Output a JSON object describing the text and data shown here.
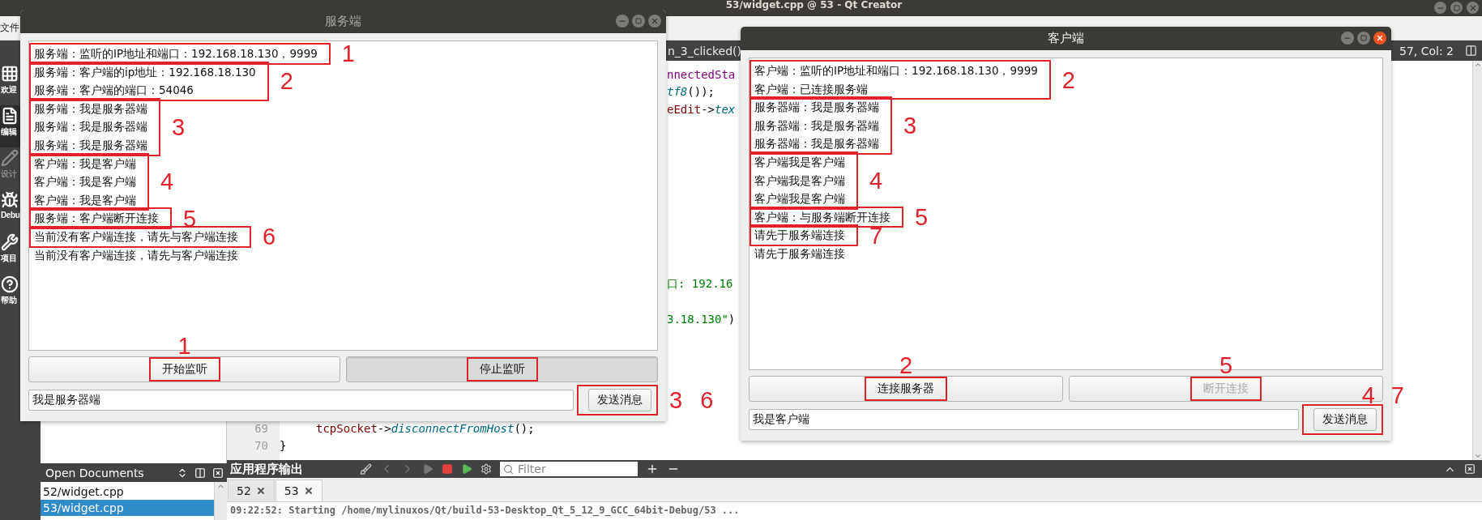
{
  "ide": {
    "title": "53/widget.cpp @ 53 - Qt Creator",
    "menu": [
      "文件"
    ],
    "modes": [
      {
        "label": "欢迎",
        "selected": false,
        "disabled": false
      },
      {
        "label": "编辑",
        "selected": true,
        "disabled": false
      },
      {
        "label": "设计",
        "selected": false,
        "disabled": true
      },
      {
        "label": "Debu",
        "selected": false,
        "disabled": false
      },
      {
        "label": "项目",
        "selected": false,
        "disabled": false
      },
      {
        "label": "帮助",
        "selected": false,
        "disabled": false
      }
    ],
    "open_documents": {
      "title": "Open Documents",
      "items": [
        {
          "name": "52/widget.cpp",
          "selected": false
        },
        {
          "name": "53/widget.cpp",
          "selected": true
        }
      ]
    },
    "editor": {
      "tab": "n_3_clicked()",
      "position": "57, Col: 2",
      "fragments": [
        {
          "tokens": [
            {
              "text": "nnectedSta",
              "kind": "member"
            }
          ]
        },
        {
          "tokens": [
            {
              "text": "tf8",
              "kind": "method"
            },
            {
              "text": "());",
              "kind": "plain"
            }
          ]
        },
        {
          "tokens": [
            {
              "text": "eEdit",
              "kind": "field"
            },
            {
              "text": "->",
              "kind": "plain"
            },
            {
              "text": "tex",
              "kind": "method"
            }
          ]
        },
        {
          "tokens": [
            {
              "text": "口: 192.16",
              "kind": "string"
            }
          ]
        },
        {
          "tokens": [
            {
              "text": "3.18.130\"",
              "kind": "string"
            },
            {
              "text": ")",
              "kind": "plain"
            }
          ]
        }
      ],
      "lines": [
        {
          "number": "69",
          "indented": true,
          "tokens": [
            {
              "text": "tcpSocket",
              "kind": "field"
            },
            {
              "text": "->",
              "kind": "plain"
            },
            {
              "text": "disconnectFromHost",
              "kind": "method"
            },
            {
              "text": "();",
              "kind": "plain"
            }
          ]
        },
        {
          "number": "70",
          "indented": false,
          "tokens": [
            {
              "text": "}",
              "kind": "plain"
            }
          ]
        }
      ]
    },
    "output": {
      "title": "应用程序输出",
      "filter": {
        "placeholder": "Filter"
      },
      "tabs": [
        {
          "label": "52",
          "selected": false
        },
        {
          "label": "53",
          "selected": true
        }
      ],
      "text": "09:22:52: Starting /home/mylinuxos/Qt/build-53-Desktop_Qt_5_12_9_GCC_64bit-Debug/53 ..."
    }
  },
  "server": {
    "title": "服务端",
    "active": false,
    "log": [
      {
        "lines": [
          "服务端：监听的IP地址和端口：192.168.18.130，9999"
        ],
        "note": "1"
      },
      {
        "lines": [
          "服务端：客户端的ip地址：192.168.18.130",
          "服务端：客户端的端口：54046"
        ],
        "note": "2"
      },
      {
        "lines": [
          "服务端：我是服务器端",
          "服务端：我是服务器端",
          "服务端：我是服务器端"
        ],
        "note": "3"
      },
      {
        "lines": [
          "客户端：我是客户端",
          "客户端：我是客户端",
          "客户端：我是客户端"
        ],
        "note": "4"
      },
      {
        "lines": [
          "服务端：客户端断开连接"
        ],
        "note": "5"
      },
      {
        "lines": [
          "当前没有客户端连接，请先与客户端连接"
        ],
        "note": "6"
      },
      {
        "lines": [
          "当前没有客户端连接，请先与客户端连接"
        ]
      }
    ],
    "buttons": [
      {
        "label": "开始监听",
        "pressed": false,
        "disabled": false,
        "framed": true,
        "notes": [
          "1"
        ]
      },
      {
        "label": "停止监听",
        "pressed": true,
        "disabled": false,
        "framed": true
      }
    ],
    "input": {
      "value": "我是服务器端"
    },
    "send": {
      "label": "发送消息",
      "framed": true,
      "notes": [
        "3",
        "6"
      ]
    }
  },
  "client": {
    "title": "客户端",
    "active": true,
    "log": [
      {
        "lines": [
          "客户端：监听的IP地址和端口：192.168.18.130，9999",
          "客户端：已连接服务端"
        ],
        "note": "2"
      },
      {
        "lines": [
          "服务器端：我是服务器端",
          "服务器端：我是服务器端",
          "服务器端：我是服务器端"
        ],
        "note": "3"
      },
      {
        "lines": [
          "客户端我是客户端",
          "客户端我是客户端",
          "客户端我是客户端"
        ],
        "note": "4"
      },
      {
        "lines": [
          "客户端：与服务端断开连接"
        ],
        "note": "5"
      },
      {
        "lines": [
          "请先于服务端连接"
        ],
        "note": "7"
      },
      {
        "lines": [
          "请先于服务端连接"
        ]
      }
    ],
    "buttons": [
      {
        "label": "连接服务器",
        "pressed": false,
        "disabled": false,
        "framed": true,
        "notes": [
          "2"
        ]
      },
      {
        "label": "断开连接",
        "pressed": false,
        "disabled": true,
        "framed": true,
        "notes": [
          "5"
        ]
      }
    ],
    "input": {
      "value": "我是客户端"
    },
    "send": {
      "label": "发送消息",
      "framed": true,
      "notes": [
        "4",
        "7"
      ]
    }
  }
}
